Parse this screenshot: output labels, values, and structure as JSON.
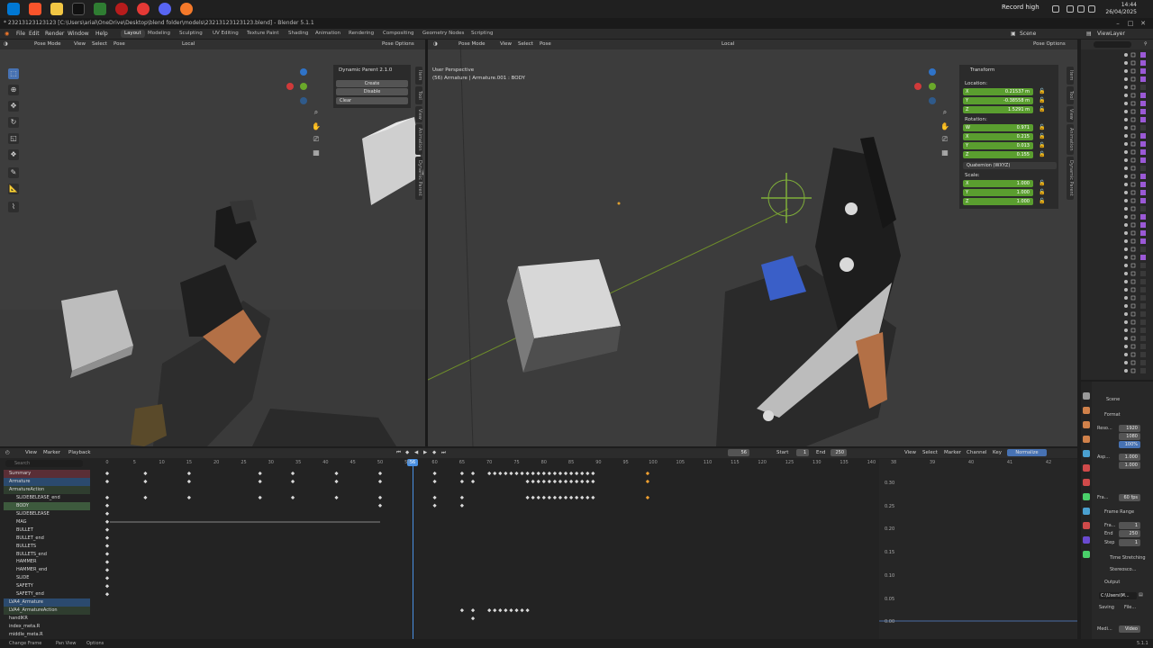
{
  "taskbar": {
    "record_label": "Record high",
    "time": "14:44",
    "date": "26/04/2025"
  },
  "title": "* 23213123123123 [C:\\Users\\arial\\OneDrive\\Desktop\\blend folder\\models\\23213123123123.blend] - Blender 5.1.1",
  "menu": {
    "file": "File",
    "edit": "Edit",
    "render": "Render",
    "window": "Window",
    "help": "Help"
  },
  "workspaces": [
    "Layout",
    "Modeling",
    "Sculpting",
    "UV Editing",
    "Texture Paint",
    "Shading",
    "Animation",
    "Rendering",
    "Compositing",
    "Geometry Nodes",
    "Scripting"
  ],
  "top_right": {
    "scene": "Scene",
    "view_layer": "ViewLayer"
  },
  "left_viewport": {
    "mode": "Pose Mode",
    "view": "View",
    "select": "Select",
    "pose": "Pose",
    "orientation": "Local",
    "pose_options": "Pose Options",
    "dynamic_parent": {
      "title": "Dynamic Parent 2.1.0",
      "create": "Create",
      "disable": "Disable",
      "clear": "Clear"
    },
    "side_tabs": [
      "Item",
      "Tool",
      "View",
      "Animation",
      "Dynamic Parent"
    ]
  },
  "right_viewport": {
    "mode": "Pose Mode",
    "view": "View",
    "select": "Select",
    "pose": "Pose",
    "orientation": "Local",
    "pose_options": "Pose Options",
    "overlay_line1": "User Perspective",
    "overlay_line2": "(56) Armature | Armature.001 : BODY",
    "transform": {
      "title": "Transform",
      "location_label": "Location:",
      "location": [
        {
          "k": "X",
          "v": "0.21537 m"
        },
        {
          "k": "Y",
          "v": "-0.38558 m"
        },
        {
          "k": "Z",
          "v": "1.5291 m"
        }
      ],
      "rotation_label": "Rotation:",
      "rotation": [
        {
          "k": "W",
          "v": "0.971"
        },
        {
          "k": "X",
          "v": "0.215"
        },
        {
          "k": "Y",
          "v": "0.013"
        },
        {
          "k": "Z",
          "v": "0.155"
        }
      ],
      "rotation_mode": "Quaternion (WXYZ)",
      "scale_label": "Scale:",
      "scale": [
        {
          "k": "X",
          "v": "1.000"
        },
        {
          "k": "Y",
          "v": "1.000"
        },
        {
          "k": "Z",
          "v": "1.000"
        }
      ]
    },
    "side_tabs": [
      "Item",
      "Tool",
      "View",
      "Animation",
      "Dynamic Parent"
    ]
  },
  "timeline": {
    "view": "View",
    "marker": "Marker",
    "playback": "Playback",
    "current_frame": "56",
    "start_label": "Start",
    "start": "1",
    "end_label": "End",
    "end": "250",
    "graph_menu": [
      "View",
      "Select",
      "Marker",
      "Channel",
      "Key"
    ],
    "normalize": "Normalize",
    "search_placeholder": "Search",
    "ruler": [
      "0",
      "5",
      "10",
      "15",
      "20",
      "25",
      "30",
      "35",
      "40",
      "45",
      "50",
      "55",
      "60",
      "65",
      "70",
      "75",
      "80",
      "85",
      "90",
      "95",
      "100",
      "105",
      "110",
      "115",
      "120",
      "125",
      "130",
      "135",
      "140"
    ],
    "graph_ruler": [
      "38",
      "39",
      "40",
      "41",
      "42"
    ],
    "graph_values": [
      "0.30",
      "0.25",
      "0.20",
      "0.15",
      "0.10",
      "0.05",
      "0.00"
    ],
    "channels": [
      "Summary",
      "Armature",
      "ArmatureAction",
      "SLIDEBELEASE_end",
      "BODY",
      "SLIDEBELEASE",
      "MAG",
      "BULLET",
      "BULLET_end",
      "BULLETS",
      "BULLETS_end",
      "HAMMER",
      "HAMMER_end",
      "SLIDE",
      "SAFETY",
      "SAFETY_end",
      "LVA4_Armature",
      "LVA4_ArmatureAction",
      "handIKR",
      "index_meta.R",
      "middle_meta.R"
    ]
  },
  "outliner": {
    "search_placeholder": ""
  },
  "properties": {
    "scene": "Scene",
    "format": "Format",
    "reso_label": "Reso...",
    "reso_x": "1920",
    "reso_y": "1080",
    "reso_pct": "100%",
    "aspect_label": "Asp...",
    "aspect_x": "1.000",
    "aspect_y": "1.000",
    "frame_rate": "60 fps",
    "frame_rate_label": "Fra...",
    "frame_range": "Frame Range",
    "fr_start_label": "Fra...",
    "fr_start": "1",
    "fr_end_label": "End",
    "fr_end": "250",
    "fr_step_label": "Step",
    "fr_step": "1",
    "time_stretching": "Time Stretching",
    "stereoscopy": "Stereosco...",
    "output": "Output",
    "output_path": "C:\\Users\\M...",
    "saving_label": "Saving",
    "file_label": "File...",
    "media_label": "Medi...",
    "video_label": "Video"
  },
  "statusbar": {
    "left": "Change Frame",
    "mid": "Pan View",
    "right": "Options",
    "version": "5.1.1"
  }
}
